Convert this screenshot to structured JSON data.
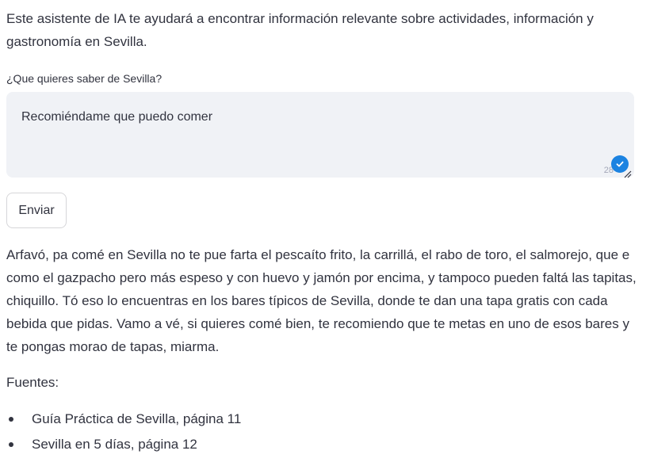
{
  "intro": {
    "text": "Este asistente de IA te ayudará a encontrar información relevante sobre actividades, información y gastronomía en Sevilla."
  },
  "question": {
    "label": "¿Que quieres saber de Sevilla?",
    "value": "Recomiéndame que puedo comer",
    "char_count": "28",
    "check_icon": "check-circle-icon",
    "accent_color": "#1c83e1"
  },
  "submit": {
    "label": "Enviar"
  },
  "answer": {
    "text": "Arfavó, pa comé en Sevilla no te pue farta el pescaíto frito, la carrillá, el rabo de toro, el salmorejo, que e como el gazpacho pero más espeso y con huevo y jamón por encima, y tampoco pueden faltá las tapitas, chiquillo. Tó eso lo encuentras en los bares típicos de Sevilla, donde te dan una tapa gratis con cada bebida que pidas. Vamo a vé, si quieres comé bien, te recomiendo que te metas en uno de esos bares y te pongas morao de tapas, miarma."
  },
  "sources": {
    "title": "Fuentes:",
    "items": [
      {
        "label": "Guía Práctica de Sevilla, página 11"
      },
      {
        "label": "Sevilla en 5 días, página 12"
      }
    ]
  }
}
